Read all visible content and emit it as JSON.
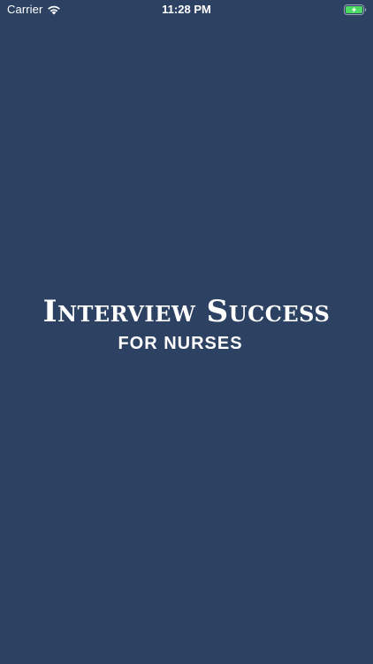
{
  "status_bar": {
    "carrier": "Carrier",
    "time": "11:28 PM",
    "battery_color": "#4cd964"
  },
  "splash": {
    "title": "Interview Success",
    "subtitle": "FOR NURSES",
    "background_color": "#2d4263",
    "text_color": "#ffffff"
  }
}
